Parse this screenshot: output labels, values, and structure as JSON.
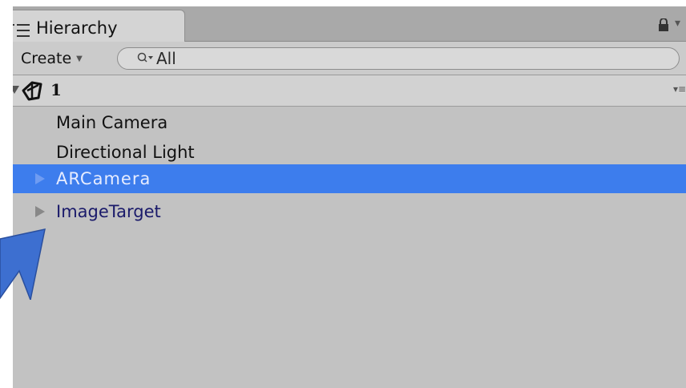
{
  "window": {
    "tab_label": "Hierarchy"
  },
  "toolbar": {
    "create_label": "Create",
    "search_value": "All"
  },
  "scene": {
    "name": "1"
  },
  "hierarchy": {
    "items": [
      {
        "label": "Main Camera"
      },
      {
        "label": "Directional Light"
      },
      {
        "label": "ARCamera"
      },
      {
        "label": "ImageTarget"
      }
    ]
  },
  "colors": {
    "selection": "#3d7ded",
    "panel_bg": "#c2c2c2",
    "prefab_text": "#1a1a6a",
    "annotation_arrow": "#3d6fd0"
  }
}
